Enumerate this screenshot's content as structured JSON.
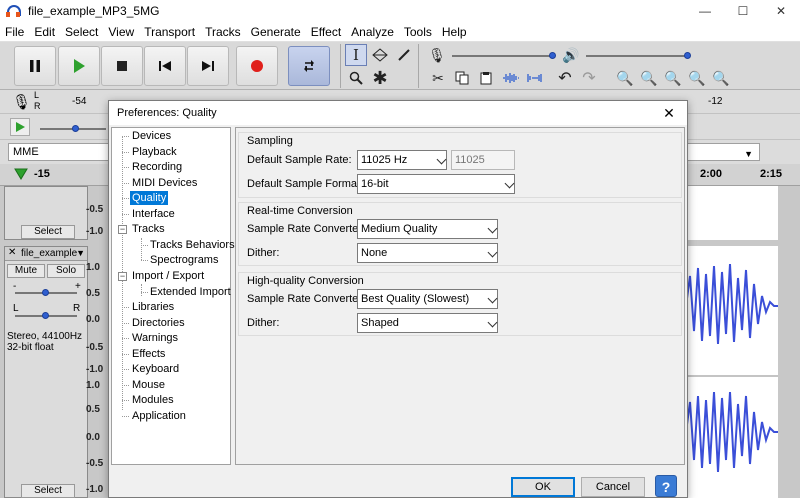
{
  "window": {
    "title": "file_example_MP3_5MG",
    "minimize": "—",
    "maximize": "☐",
    "close": "✕"
  },
  "menu": [
    "File",
    "Edit",
    "Select",
    "View",
    "Transport",
    "Tracks",
    "Generate",
    "Effect",
    "Analyze",
    "Tools",
    "Help"
  ],
  "meter": {
    "rec_db_left": "-54",
    "rec_db_right": "-12",
    "channel_left": "L",
    "channel_right": "R"
  },
  "device": {
    "host": "MME"
  },
  "ruler": {
    "start": "-15",
    "mark_1": "2:00",
    "mark_2": "2:15"
  },
  "tracks": {
    "select_label": "Select",
    "track_name": "file_example",
    "mute": "Mute",
    "solo": "Solo",
    "gain_minus": "-",
    "gain_plus": "+",
    "pan_left": "L",
    "pan_right": "R",
    "info_line1": "Stereo, 44100Hz",
    "info_line2": "32-bit float",
    "scale_top": [
      "-0.5",
      "-1.0"
    ],
    "scale_ch1": [
      "1.0",
      "0.5",
      "0.0",
      "-0.5",
      "-1.0"
    ],
    "scale_ch2": [
      "1.0",
      "0.5",
      "0.0",
      "-0.5",
      "-1.0"
    ]
  },
  "dialog": {
    "title": "Preferences: Quality",
    "close": "✕",
    "tree": [
      "Devices",
      "Playback",
      "Recording",
      "MIDI Devices",
      "Quality",
      "Interface",
      "Tracks",
      "Tracks Behaviors",
      "Spectrograms",
      "Import / Export",
      "Extended Import",
      "Libraries",
      "Directories",
      "Warnings",
      "Effects",
      "Keyboard",
      "Mouse",
      "Modules",
      "Application"
    ],
    "selected_index": 4,
    "sampling": {
      "label": "Sampling",
      "rate_label": "Default Sample Rate:",
      "rate_value": "11025 Hz",
      "rate_text": "11025",
      "format_label": "Default Sample Format:",
      "format_value": "16-bit"
    },
    "realtime": {
      "label": "Real-time Conversion",
      "converter_label": "Sample Rate Converter:",
      "converter_value": "Medium Quality",
      "dither_label": "Dither:",
      "dither_value": "None"
    },
    "highquality": {
      "label": "High-quality Conversion",
      "converter_label": "Sample Rate Converter:",
      "converter_value": "Best Quality (Slowest)",
      "dither_label": "Dither:",
      "dither_value": "Shaped"
    },
    "ok": "OK",
    "cancel": "Cancel",
    "help": "?"
  }
}
